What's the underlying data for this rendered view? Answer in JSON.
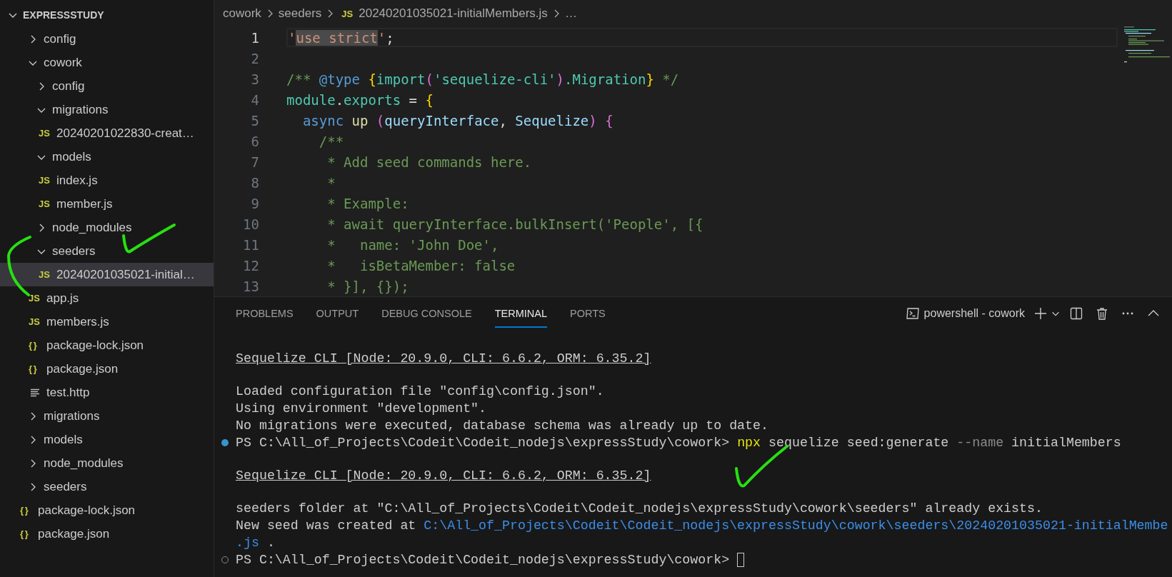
{
  "explorer": {
    "title": "EXPRESSSTUDY",
    "expanded": true,
    "tree": [
      {
        "label": "config",
        "kind": "folder",
        "expanded": false,
        "selected": false
      },
      {
        "label": "cowork",
        "kind": "folder",
        "expanded": true,
        "selected": false,
        "children": [
          {
            "label": "config",
            "kind": "folder",
            "expanded": false,
            "selected": false
          },
          {
            "label": "migrations",
            "kind": "folder",
            "expanded": true,
            "selected": false,
            "children": [
              {
                "label": "20240201022830-creat…",
                "kind": "js",
                "icon": "JS",
                "selected": false
              }
            ]
          },
          {
            "label": "models",
            "kind": "folder",
            "expanded": true,
            "selected": false,
            "children": [
              {
                "label": "index.js",
                "kind": "js",
                "icon": "JS",
                "selected": false
              },
              {
                "label": "member.js",
                "kind": "js",
                "icon": "JS",
                "selected": false
              }
            ]
          },
          {
            "label": "node_modules",
            "kind": "folder",
            "expanded": false,
            "selected": false
          },
          {
            "label": "seeders",
            "kind": "folder",
            "expanded": true,
            "selected": false,
            "children": [
              {
                "label": "20240201035021-initial…",
                "kind": "js",
                "icon": "JS",
                "selected": true
              }
            ]
          },
          {
            "label": "app.js",
            "kind": "js",
            "icon": "JS",
            "selected": false
          },
          {
            "label": "members.js",
            "kind": "js",
            "icon": "JS",
            "selected": false
          },
          {
            "label": "package-lock.json",
            "kind": "json",
            "icon": "{ }",
            "selected": false
          },
          {
            "label": "package.json",
            "kind": "json",
            "icon": "{ }",
            "selected": false
          },
          {
            "label": "test.http",
            "kind": "text",
            "selected": false
          }
        ]
      },
      {
        "label": "migrations",
        "kind": "folder",
        "expanded": false,
        "selected": false
      },
      {
        "label": "models",
        "kind": "folder",
        "expanded": false,
        "selected": false
      },
      {
        "label": "node_modules",
        "kind": "folder",
        "expanded": false,
        "selected": false
      },
      {
        "label": "seeders",
        "kind": "folder",
        "expanded": false,
        "selected": false
      },
      {
        "label": "package-lock.json",
        "kind": "json",
        "icon": "{ }",
        "selected": false
      },
      {
        "label": "package.json",
        "kind": "json",
        "icon": "{ }",
        "selected": false
      }
    ]
  },
  "breadcrumb": [
    {
      "label": "cowork",
      "kind": "folder"
    },
    {
      "label": "seeders",
      "kind": "folder"
    },
    {
      "label": "20240201035021-initialMembers.js",
      "kind": "js",
      "icon": "JS"
    },
    {
      "label": "…",
      "kind": "more"
    }
  ],
  "editor": {
    "lines": [
      {
        "number": "1",
        "current": true,
        "tokens": [
          {
            "text": "'",
            "kind": "string"
          },
          {
            "text": "use strict",
            "kind": "string-match"
          },
          {
            "text": "'",
            "kind": "string"
          },
          {
            "text": ";",
            "kind": "plain"
          }
        ]
      },
      {
        "number": "2",
        "current": false
      },
      {
        "number": "3",
        "current": false,
        "tokens": [
          {
            "text": "/** ",
            "kind": "comment"
          },
          {
            "text": "@type",
            "kind": "doc-tag"
          },
          {
            "text": " {",
            "kind": "bracket-1"
          },
          {
            "text": "import",
            "kind": "type"
          },
          {
            "text": "(",
            "kind": "bracket-2"
          },
          {
            "text": "'sequelize-cli'",
            "kind": "type"
          },
          {
            "text": ")",
            "kind": "bracket-2"
          },
          {
            "text": ".Migration",
            "kind": "type"
          },
          {
            "text": "}",
            "kind": "bracket-1"
          },
          {
            "text": " */",
            "kind": "comment"
          }
        ]
      },
      {
        "number": "4",
        "current": false,
        "tokens": [
          {
            "text": "module",
            "kind": "type"
          },
          {
            "text": ".",
            "kind": "plain"
          },
          {
            "text": "exports",
            "kind": "type"
          },
          {
            "text": " = ",
            "kind": "plain"
          },
          {
            "text": "{",
            "kind": "bracket-1"
          }
        ]
      },
      {
        "number": "5",
        "current": false,
        "tokens": [
          {
            "text": "  async",
            "kind": "keyword"
          },
          {
            "text": " up ",
            "kind": "function"
          },
          {
            "text": "(",
            "kind": "bracket-2"
          },
          {
            "text": "queryInterface",
            "kind": "variable"
          },
          {
            "text": ", ",
            "kind": "plain"
          },
          {
            "text": "Sequelize",
            "kind": "variable"
          },
          {
            "text": ") {",
            "kind": "bracket-2"
          }
        ]
      },
      {
        "number": "6",
        "current": false,
        "tokens": [
          {
            "text": "    /**",
            "kind": "comment"
          }
        ]
      },
      {
        "number": "7",
        "current": false,
        "tokens": [
          {
            "text": "     * Add seed commands here.",
            "kind": "comment"
          }
        ]
      },
      {
        "number": "8",
        "current": false,
        "tokens": [
          {
            "text": "     *",
            "kind": "comment"
          }
        ]
      },
      {
        "number": "9",
        "current": false,
        "tokens": [
          {
            "text": "     * Example:",
            "kind": "comment"
          }
        ]
      },
      {
        "number": "10",
        "current": false,
        "tokens": [
          {
            "text": "     * await queryInterface.bulkInsert('People', [{",
            "kind": "comment"
          }
        ]
      },
      {
        "number": "11",
        "current": false,
        "tokens": [
          {
            "text": "     *   name: 'John Doe',",
            "kind": "comment"
          }
        ]
      },
      {
        "number": "12",
        "current": false,
        "tokens": [
          {
            "text": "     *   isBetaMember: false",
            "kind": "comment"
          }
        ]
      },
      {
        "number": "13",
        "current": false,
        "tokens": [
          {
            "text": "     * }], {});",
            "kind": "comment"
          }
        ]
      }
    ]
  },
  "panel": {
    "tabs": [
      {
        "label": "PROBLEMS",
        "selected": false
      },
      {
        "label": "OUTPUT",
        "selected": false
      },
      {
        "label": "DEBUG CONSOLE",
        "selected": false
      },
      {
        "label": "TERMINAL",
        "selected": true
      },
      {
        "label": "PORTS",
        "selected": false
      }
    ],
    "terminal_name": "powershell - cowork",
    "terminal": [
      {
        "kind": "output",
        "parts": [
          {
            "text": "Sequelize CLI [Node: 20.9.0, CLI: 6.6.2, ORM: 6.35.2]",
            "kind": "underline"
          }
        ]
      },
      {
        "kind": "blank"
      },
      {
        "kind": "output",
        "parts": [
          {
            "text": "Loaded configuration file \"config\\config.json\".",
            "kind": "plain"
          }
        ]
      },
      {
        "kind": "output",
        "parts": [
          {
            "text": "Using environment \"development\".",
            "kind": "plain"
          }
        ]
      },
      {
        "kind": "output",
        "parts": [
          {
            "text": "No migrations were executed, database schema was already up to date.",
            "kind": "plain"
          }
        ]
      },
      {
        "kind": "prompt",
        "succeeded": true,
        "cursor": false,
        "parts": [
          {
            "text": "PS C:\\All_of_Projects\\Codeit\\Codeit_nodejs\\expressStudy\\cowork> ",
            "kind": "plain"
          },
          {
            "text": "npx",
            "kind": "command"
          },
          {
            "text": " sequelize seed:generate ",
            "kind": "plain"
          },
          {
            "text": "--name",
            "kind": "flag"
          },
          {
            "text": " initialMembers",
            "kind": "plain"
          }
        ]
      },
      {
        "kind": "blank"
      },
      {
        "kind": "output",
        "parts": [
          {
            "text": "Sequelize CLI [Node: 20.9.0, CLI: 6.6.2, ORM: 6.35.2]",
            "kind": "underline"
          }
        ]
      },
      {
        "kind": "blank"
      },
      {
        "kind": "output",
        "parts": [
          {
            "text": "seeders folder at \"C:\\All_of_Projects\\Codeit\\Codeit_nodejs\\expressStudy\\cowork\\seeders\" already exists.",
            "kind": "plain"
          }
        ]
      },
      {
        "kind": "output",
        "parts": [
          {
            "text": "New seed was created at ",
            "kind": "plain"
          },
          {
            "text": "C:\\All_of_Projects\\Codeit\\Codeit_nodejs\\expressStudy\\cowork\\seeders\\20240201035021-initialMembe",
            "kind": "link"
          }
        ]
      },
      {
        "kind": "output",
        "parts": [
          {
            "text": ".js",
            "kind": "link"
          },
          {
            "text": " .",
            "kind": "plain"
          }
        ]
      },
      {
        "kind": "prompt",
        "succeeded": false,
        "cursor": true,
        "parts": [
          {
            "text": "PS C:\\All_of_Projects\\Codeit\\Codeit_nodejs\\expressStudy\\cowork> ",
            "kind": "plain"
          }
        ]
      }
    ]
  }
}
